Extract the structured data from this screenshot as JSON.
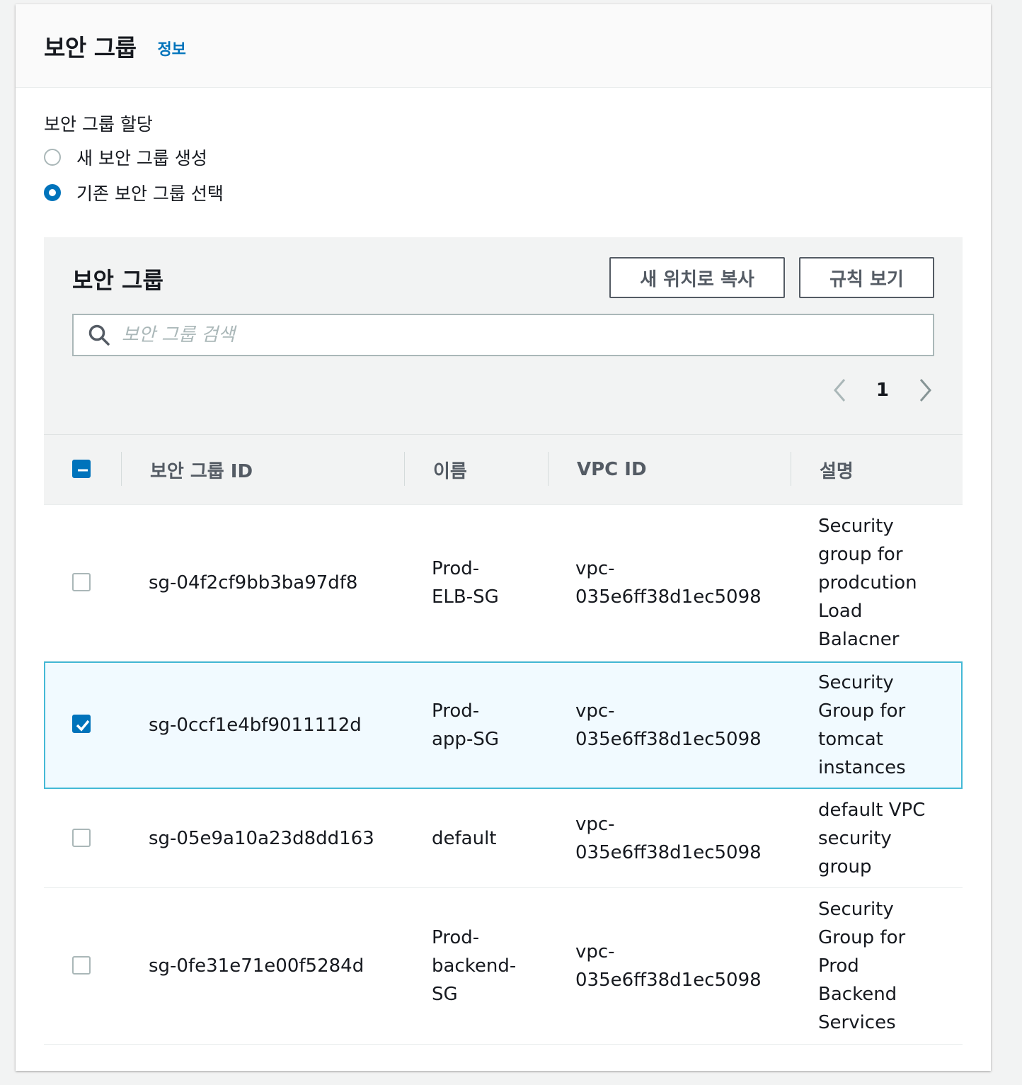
{
  "panel": {
    "title": "보안 그룹",
    "info": "정보"
  },
  "assign": {
    "label": "보안 그룹 할당",
    "options": [
      {
        "label": "새 보안 그룹 생성",
        "checked": false
      },
      {
        "label": "기존 보안 그룹 선택",
        "checked": true
      }
    ]
  },
  "table_section": {
    "title": "보안 그룹",
    "copy_button": "새 위치로 복사",
    "rules_button": "규칙 보기",
    "search_placeholder": "보안 그룹 검색",
    "page": "1"
  },
  "table": {
    "columns": [
      "보안 그룹 ID",
      "이름",
      "VPC ID",
      "설명"
    ],
    "rows": [
      {
        "id": "sg-04f2cf9bb3ba97df8",
        "name": [
          "Prod-",
          "ELB-SG"
        ],
        "vpc": [
          "vpc-",
          "035e6ff38d1ec5098"
        ],
        "desc": [
          "Security",
          "group for",
          "prodcution",
          "Load",
          "Balacner"
        ],
        "selected": false
      },
      {
        "id": "sg-0ccf1e4bf9011112d",
        "name": [
          "Prod-",
          "app-SG"
        ],
        "vpc": [
          "vpc-",
          "035e6ff38d1ec5098"
        ],
        "desc": [
          "Security",
          "Group for",
          "tomcat",
          "instances"
        ],
        "selected": true
      },
      {
        "id": "sg-05e9a10a23d8dd163",
        "name": [
          "default"
        ],
        "vpc": [
          "vpc-",
          "035e6ff38d1ec5098"
        ],
        "desc": [
          "default VPC",
          "security",
          "group"
        ],
        "selected": false
      },
      {
        "id": "sg-0fe31e71e00f5284d",
        "name": [
          "Prod-",
          "backend-",
          "SG"
        ],
        "vpc": [
          "vpc-",
          "035e6ff38d1ec5098"
        ],
        "desc": [
          "Security",
          "Group for",
          "Prod",
          "Backend",
          "Services"
        ],
        "selected": false
      }
    ]
  },
  "colors": {
    "accent": "#0073bb",
    "selected_bg": "#f1faff",
    "selected_border": "#44b9d6"
  },
  "icons": [
    "search-icon",
    "chevron-left-icon",
    "chevron-right-icon",
    "checkbox-indeterminate-icon",
    "checkmark-icon"
  ]
}
